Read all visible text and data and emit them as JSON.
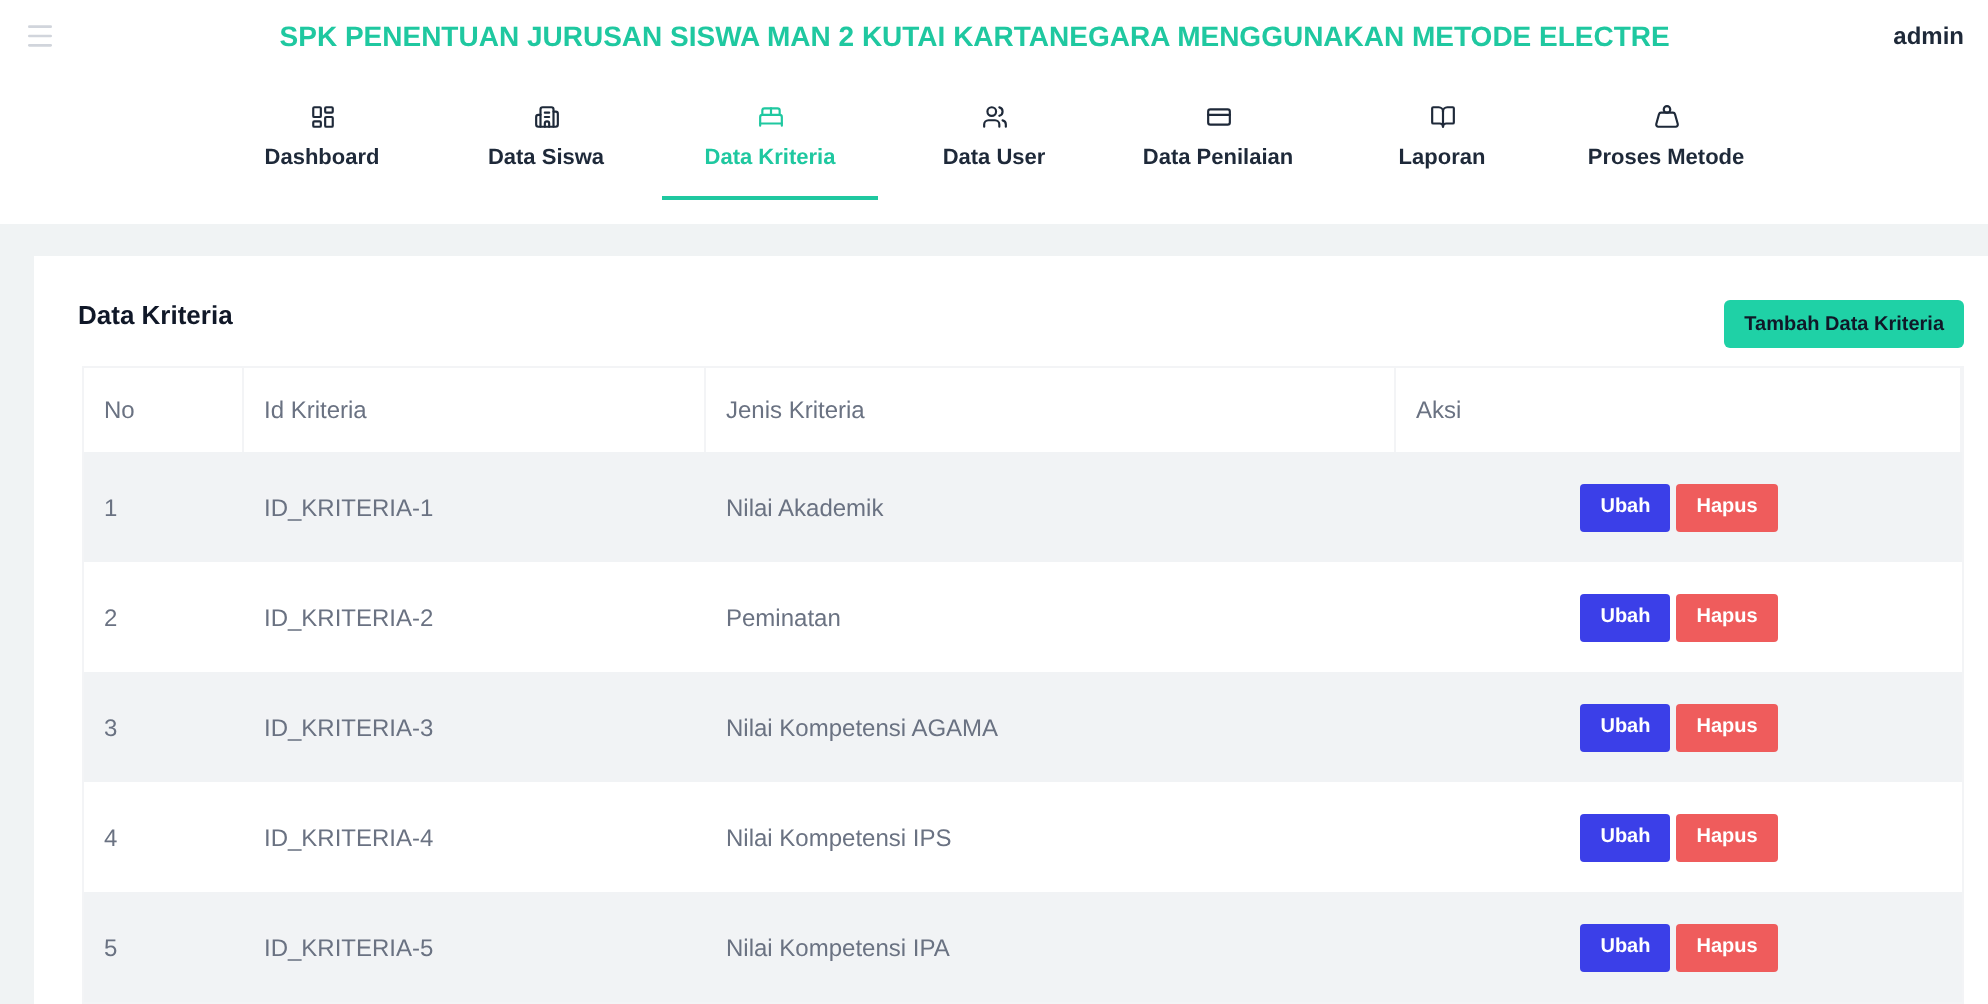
{
  "header": {
    "title": "SPK PENENTUAN JURUSAN SISWA MAN 2 KUTAI KARTANEGARA MENGGUNAKAN METODE ELECTRE",
    "user": "admin"
  },
  "nav": [
    {
      "label": "Dashboard",
      "kind": "dashboard",
      "selected": false
    },
    {
      "label": "Data Siswa",
      "kind": "building",
      "selected": false
    },
    {
      "label": "Data Kriteria",
      "kind": "bed",
      "selected": true
    },
    {
      "label": "Data User",
      "kind": "users",
      "selected": false
    },
    {
      "label": "Data Penilaian",
      "kind": "card",
      "selected": false
    },
    {
      "label": "Laporan",
      "kind": "book",
      "selected": false
    },
    {
      "label": "Proses Metode",
      "kind": "weight",
      "selected": false
    }
  ],
  "card": {
    "title": "Data Kriteria",
    "add_button": "Tambah Data Kriteria"
  },
  "table": {
    "columns": [
      "No",
      "Id Kriteria",
      "Jenis Kriteria",
      "Aksi"
    ],
    "rows": [
      {
        "no": "1",
        "id": "ID_KRITERIA-1",
        "jenis": "Nilai Akademik",
        "edit": "Ubah",
        "delete": "Hapus"
      },
      {
        "no": "2",
        "id": "ID_KRITERIA-2",
        "jenis": "Peminatan",
        "edit": "Ubah",
        "delete": "Hapus"
      },
      {
        "no": "3",
        "id": "ID_KRITERIA-3",
        "jenis": "Nilai Kompetensi AGAMA",
        "edit": "Ubah",
        "delete": "Hapus"
      },
      {
        "no": "4",
        "id": "ID_KRITERIA-4",
        "jenis": "Nilai Kompetensi IPS",
        "edit": "Ubah",
        "delete": "Hapus"
      },
      {
        "no": "5",
        "id": "ID_KRITERIA-5",
        "jenis": "Nilai Kompetensi IPA",
        "edit": "Ubah",
        "delete": "Hapus"
      }
    ]
  }
}
